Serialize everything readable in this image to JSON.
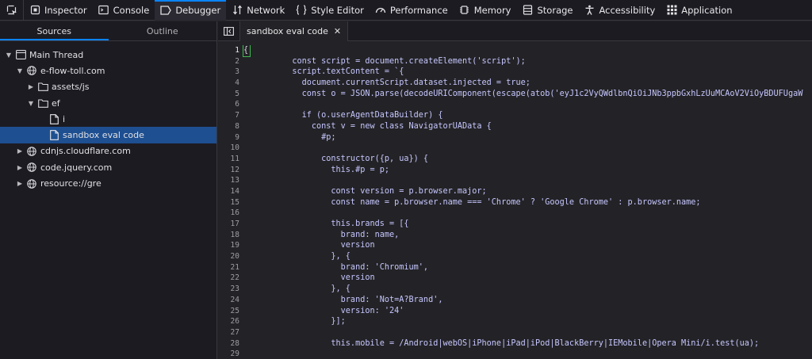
{
  "toolbar": {
    "tabs": [
      {
        "label": "Inspector",
        "icon": "inspector-icon"
      },
      {
        "label": "Console",
        "icon": "console-icon"
      },
      {
        "label": "Debugger",
        "icon": "debugger-icon"
      },
      {
        "label": "Network",
        "icon": "network-icon"
      },
      {
        "label": "Style Editor",
        "icon": "style-editor-icon"
      },
      {
        "label": "Performance",
        "icon": "performance-icon"
      },
      {
        "label": "Memory",
        "icon": "memory-icon"
      },
      {
        "label": "Storage",
        "icon": "storage-icon"
      },
      {
        "label": "Accessibility",
        "icon": "accessibility-icon"
      },
      {
        "label": "Application",
        "icon": "application-icon"
      }
    ],
    "active_tab": "Debugger"
  },
  "left_panel": {
    "tabs": {
      "sources": "Sources",
      "outline": "Outline"
    },
    "tree": [
      {
        "label": "Main Thread",
        "icon": "window-icon",
        "expanded": true,
        "level": 0
      },
      {
        "label": "e-flow-toll.com",
        "icon": "globe-icon",
        "expanded": true,
        "level": 1
      },
      {
        "label": "assets/js",
        "icon": "folder-icon",
        "expanded": false,
        "level": 2
      },
      {
        "label": "ef",
        "icon": "folder-icon",
        "expanded": true,
        "level": 2
      },
      {
        "label": "i",
        "icon": "file-icon",
        "level": 3
      },
      {
        "label": "sandbox eval code",
        "icon": "file-icon",
        "level": 3,
        "selected": true
      },
      {
        "label": "cdnjs.cloudflare.com",
        "icon": "globe-icon",
        "expanded": false,
        "level": 1
      },
      {
        "label": "code.jquery.com",
        "icon": "globe-icon",
        "expanded": false,
        "level": 1
      },
      {
        "label": "resource://gre",
        "icon": "globe-icon",
        "expanded": false,
        "level": 1
      }
    ]
  },
  "editor": {
    "tab_label": "sandbox eval code",
    "close_glyph": "✕",
    "line_numbers": [
      "1",
      "2",
      "3",
      "4",
      "5",
      "6",
      "7",
      "8",
      "9",
      "10",
      "11",
      "12",
      "13",
      "14",
      "15",
      "16",
      "17",
      "18",
      "19",
      "20",
      "21",
      "22",
      "23",
      "24",
      "25",
      "26",
      "27",
      "28",
      "29"
    ],
    "current_line": 1,
    "code_lines": [
      "{",
      "          const script = document.createElement('script');",
      "          script.textContent = `{",
      "            document.currentScript.dataset.injected = true;",
      "            const o = JSON.parse(decodeURIComponent(escape(atob('eyJ1c2VyQWdlbnQiOiJNb3ppbGxhLzUuMCAoV2ViOyBDUFUgaW",
      "",
      "            if (o.userAgentDataBuilder) {",
      "              const v = new class NavigatorUAData {",
      "                #p;",
      "",
      "                constructor({p, ua}) {",
      "                  this.#p = p;",
      "",
      "                  const version = p.browser.major;",
      "                  const name = p.browser.name === 'Chrome' ? 'Google Chrome' : p.browser.name;",
      "",
      "                  this.brands = [{",
      "                    brand: name,",
      "                    version",
      "                  }, {",
      "                    brand: 'Chromium',",
      "                    version",
      "                  }, {",
      "                    brand: 'Not=A?Brand',",
      "                    version: '24'",
      "                  }];",
      "",
      "                  this.mobile = /Android|webOS|iPhone|iPad|iPod|BlackBerry|IEMobile|Opera Mini/i.test(ua);",
      ""
    ]
  },
  "colors": {
    "toolbar_bg": "#1c1b22",
    "editor_bg": "#232327",
    "selection": "#1e4f91",
    "accent": "#0a84ff",
    "code_text": "#c6c6ff",
    "bracket_match": "#3fb950"
  }
}
